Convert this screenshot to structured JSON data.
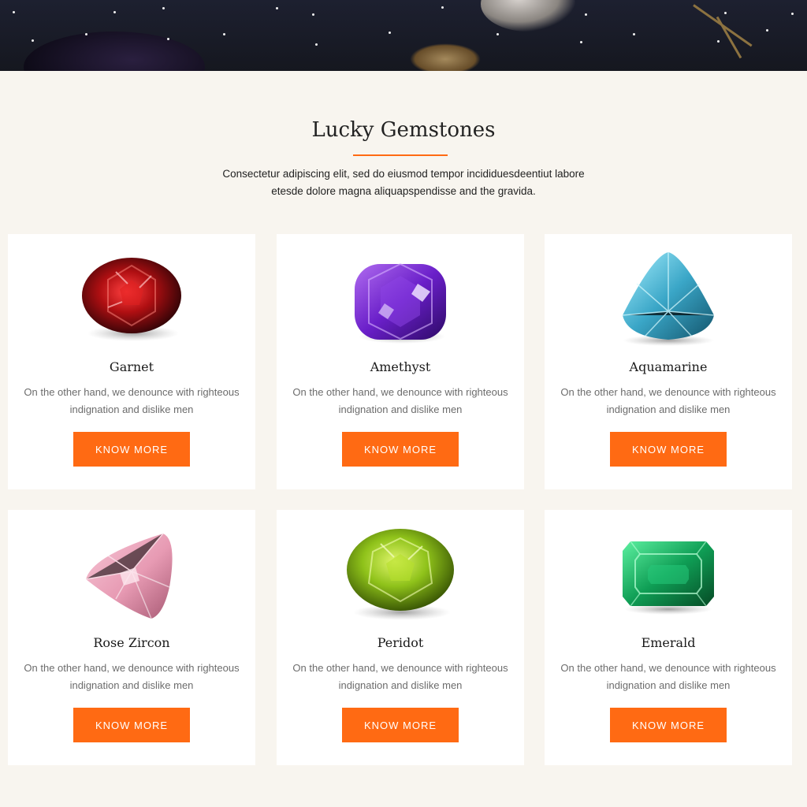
{
  "section": {
    "title": "Lucky Gemstones",
    "intro_line1": "Consectetur adipiscing elit, sed do eiusmod tempor incididuesdeentiut labore",
    "intro_line2": "etesde dolore magna aliquapspendisse and the gravida."
  },
  "colors": {
    "accent": "#ff6a13",
    "background": "#f8f5ef",
    "card": "#ffffff"
  },
  "gems": [
    {
      "name": "Garnet",
      "icon": "garnet-gem-icon",
      "description": "On the other hand, we denounce with righteous indignation and dislike men",
      "button_label": "KNOW MORE"
    },
    {
      "name": "Amethyst",
      "icon": "amethyst-gem-icon",
      "description": "On the other hand, we denounce with righteous indignation and dislike men",
      "button_label": "KNOW MORE"
    },
    {
      "name": "Aquamarine",
      "icon": "aquamarine-gem-icon",
      "description": "On the other hand, we denounce with righteous indignation and dislike men",
      "button_label": "KNOW MORE"
    },
    {
      "name": "Rose Zircon",
      "icon": "rose-zircon-gem-icon",
      "description": "On the other hand, we denounce with righteous indignation and dislike men",
      "button_label": "KNOW MORE"
    },
    {
      "name": "Peridot",
      "icon": "peridot-gem-icon",
      "description": "On the other hand, we denounce with righteous indignation and dislike men",
      "button_label": "KNOW MORE"
    },
    {
      "name": "Emerald",
      "icon": "emerald-gem-icon",
      "description": "On the other hand, we denounce with righteous indignation and dislike men",
      "button_label": "KNOW MORE"
    }
  ]
}
